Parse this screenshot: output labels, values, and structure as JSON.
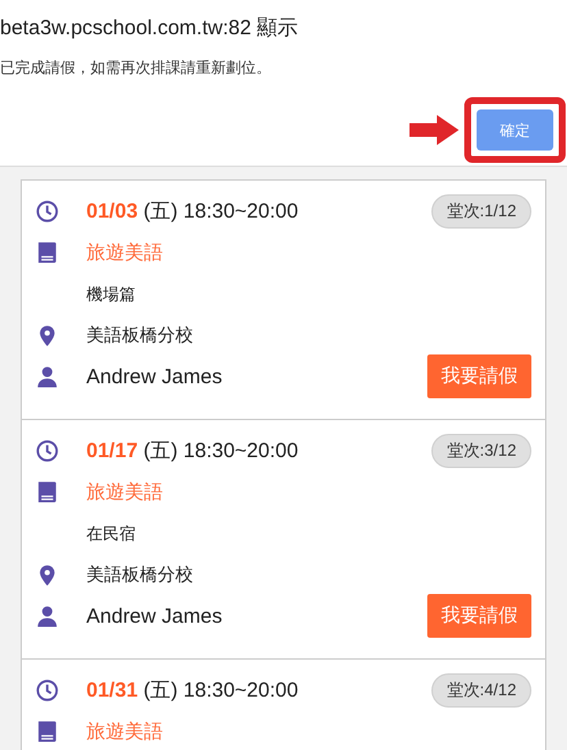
{
  "dialog": {
    "title": "beta3w.pcschool.com.tw:82 顯示",
    "message": "已完成請假，如需再次排課請重新劃位。",
    "ok_button": "確定",
    "highlighted": true
  },
  "lessons": [
    {
      "date": "01/03",
      "weekday": "(五)",
      "time": "18:30~20:00",
      "count": "堂次:1/12",
      "course": "旅遊美語",
      "topic": "機場篇",
      "location": "美語板橋分校",
      "teacher": "Andrew James",
      "leave_button": "我要請假"
    },
    {
      "date": "01/17",
      "weekday": "(五)",
      "time": "18:30~20:00",
      "count": "堂次:3/12",
      "course": "旅遊美語",
      "topic": "在民宿",
      "location": "美語板橋分校",
      "teacher": "Andrew James",
      "leave_button": "我要請假"
    },
    {
      "date": "01/31",
      "weekday": "(五)",
      "time": "18:30~20:00",
      "count": "堂次:4/12",
      "course": "旅遊美語"
    }
  ]
}
